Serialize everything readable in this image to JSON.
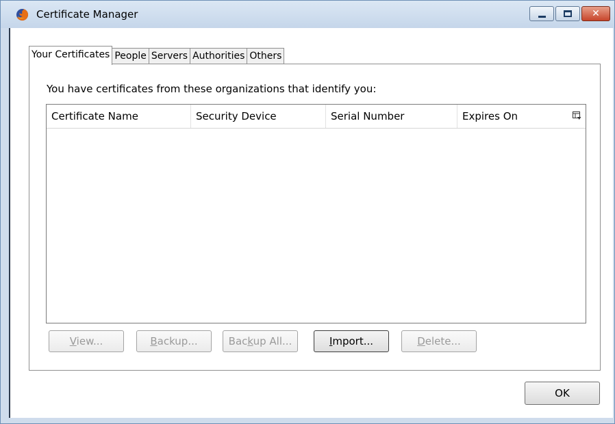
{
  "window": {
    "title": "Certificate Manager",
    "app_icon": "firefox-icon"
  },
  "tabs": [
    {
      "label": "Your Certificates",
      "active": true
    },
    {
      "label": "People",
      "active": false
    },
    {
      "label": "Servers",
      "active": false
    },
    {
      "label": "Authorities",
      "active": false
    },
    {
      "label": "Others",
      "active": false
    }
  ],
  "panel": {
    "intro": "You have certificates from these organizations that identify you:",
    "columns": [
      "Certificate Name",
      "Security Device",
      "Serial Number",
      "Expires On"
    ],
    "rows": []
  },
  "buttons": {
    "view": {
      "pre": "",
      "u": "V",
      "post": "iew...",
      "enabled": false
    },
    "backup": {
      "pre": "",
      "u": "B",
      "post": "ackup...",
      "enabled": false
    },
    "backup_all": {
      "pre": "Bac",
      "u": "k",
      "post": "up All...",
      "enabled": false
    },
    "import": {
      "pre": "",
      "u": "I",
      "post": "mport...",
      "enabled": true
    },
    "delete": {
      "pre": "",
      "u": "D",
      "post": "elete...",
      "enabled": false
    },
    "ok": "OK"
  }
}
